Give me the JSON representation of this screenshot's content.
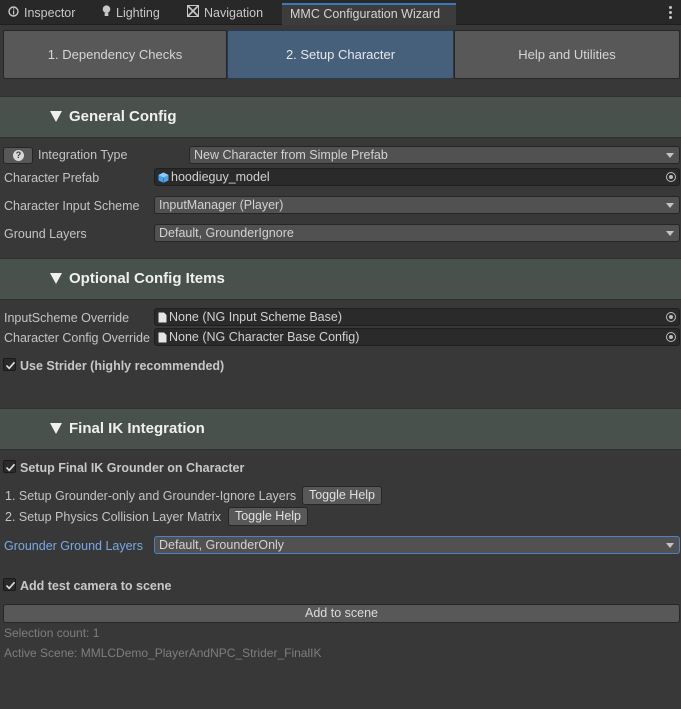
{
  "tabs": [
    {
      "label": "Inspector",
      "icon": "inspector-icon"
    },
    {
      "label": "Lighting",
      "icon": "lightbulb-icon"
    },
    {
      "label": "Navigation",
      "icon": "navigation-icon"
    },
    {
      "label": "MMC Configuration Wizard",
      "icon": ""
    }
  ],
  "steps": [
    "1. Dependency Checks",
    "2. Setup Character",
    "Help and Utilities"
  ],
  "active_step": 1,
  "general": {
    "title": "General Config",
    "integration_type_label": "Integration Type",
    "integration_type_value": "New Character from Simple Prefab",
    "prefab_label": "Character Prefab",
    "prefab_value": "hoodieguy_model",
    "input_scheme_label": "Character Input Scheme",
    "input_scheme_value": "InputManager (Player)",
    "ground_layers_label": "Ground Layers",
    "ground_layers_value": "Default, GrounderIgnore"
  },
  "optional": {
    "title": "Optional Config Items",
    "input_override_label": "InputScheme Override",
    "input_override_value": "None (NG Input Scheme Base)",
    "config_override_label": "Character Config Override",
    "config_override_value": "None (NG Character Base Config)",
    "use_strider_label": "Use Strider (highly recommended)",
    "use_strider_checked": true
  },
  "finalik": {
    "title": "Final IK Integration",
    "setup_grounder_label": "Setup Final IK Grounder on Character",
    "setup_grounder_checked": true,
    "step1_label": "1. Setup Grounder-only and Grounder-Ignore Layers",
    "step2_label": "2. Setup Physics Collision Layer Matrix",
    "toggle_help_label": "Toggle Help",
    "grounder_layers_label": "Grounder Ground Layers",
    "grounder_layers_value": "Default, GrounderOnly"
  },
  "camera": {
    "add_camera_label": "Add test camera to scene",
    "add_camera_checked": true,
    "add_button_label": "Add to scene"
  },
  "status": {
    "selection_count": "Selection count: 1",
    "active_scene": "Active Scene: MMLCDemo_PlayerAndNPC_Strider_FinalIK"
  },
  "colors": {
    "accent": "#46607c",
    "section_header": "#48514b",
    "focus": "#4a82c8"
  }
}
